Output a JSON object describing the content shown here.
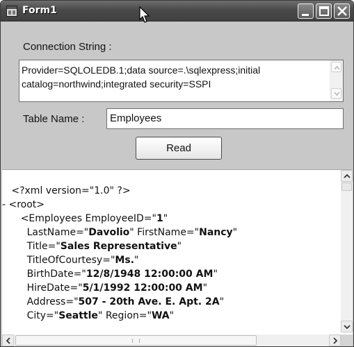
{
  "window": {
    "title": "Form1"
  },
  "form": {
    "connection_label": "Connection String :",
    "connection_value": "Provider=SQLOLEDB.1;data source=.\\sqlexpress;initial catalog=northwind;integrated security=SSPI",
    "table_label": "Table Name :",
    "table_value": "Employees",
    "read_button": "Read"
  },
  "xml": {
    "lines": [
      {
        "indent": "   ",
        "parts": [
          {
            "t": "<?xml version=\"1.0\" ?>"
          }
        ]
      },
      {
        "indent": "",
        "parts": [
          {
            "t": "- <root>"
          }
        ]
      },
      {
        "indent": "      ",
        "parts": [
          {
            "t": "<Employees EmployeeID=\""
          },
          {
            "t": "1",
            "b": true
          },
          {
            "t": "\""
          }
        ]
      },
      {
        "indent": "        ",
        "parts": [
          {
            "t": "LastName=\""
          },
          {
            "t": "Davolio",
            "b": true
          },
          {
            "t": "\" FirstName=\""
          },
          {
            "t": "Nancy",
            "b": true
          },
          {
            "t": "\""
          }
        ]
      },
      {
        "indent": "        ",
        "parts": [
          {
            "t": "Title=\""
          },
          {
            "t": "Sales Representative",
            "b": true
          },
          {
            "t": "\""
          }
        ]
      },
      {
        "indent": "        ",
        "parts": [
          {
            "t": "TitleOfCourtesy=\""
          },
          {
            "t": "Ms.",
            "b": true
          },
          {
            "t": "\""
          }
        ]
      },
      {
        "indent": "        ",
        "parts": [
          {
            "t": "BirthDate=\""
          },
          {
            "t": "12/8/1948 12:00:00 AM",
            "b": true
          },
          {
            "t": "\""
          }
        ]
      },
      {
        "indent": "        ",
        "parts": [
          {
            "t": "HireDate=\""
          },
          {
            "t": "5/1/1992 12:00:00 AM",
            "b": true
          },
          {
            "t": "\""
          }
        ]
      },
      {
        "indent": "        ",
        "parts": [
          {
            "t": "Address=\""
          },
          {
            "t": "507 - 20th Ave. E. Apt. 2A",
            "b": true
          },
          {
            "t": "\""
          }
        ]
      },
      {
        "indent": "        ",
        "parts": [
          {
            "t": "City=\""
          },
          {
            "t": "Seattle",
            "b": true
          },
          {
            "t": "\" Region=\""
          },
          {
            "t": "WA",
            "b": true
          },
          {
            "t": "\""
          }
        ]
      }
    ]
  },
  "icons": {
    "app": "form-icon",
    "minimize": "minimize-icon",
    "maximize": "maximize-icon",
    "close": "close-icon",
    "cursor": "mouse-cursor-icon"
  }
}
